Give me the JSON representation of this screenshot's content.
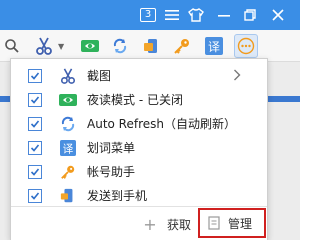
{
  "titlebar": {
    "tab_count": "3",
    "icons": [
      "tabs-count-icon",
      "menu-icon",
      "skin-icon",
      "minimize-icon",
      "restore-icon",
      "close-icon"
    ],
    "color": "#3a8ee6"
  },
  "toolbar": {
    "icons": [
      "search-icon",
      "scissors-icon",
      "night-mode-icon",
      "auto-refresh-icon",
      "account-helper-icon",
      "key-icon",
      "translate-icon",
      "more-icon"
    ]
  },
  "menu": {
    "items": [
      {
        "label": "截图",
        "icon": "scissors-icon",
        "checked": true,
        "has_submenu": true
      },
      {
        "label": "夜读模式 - 已关闭",
        "icon": "night-mode-icon",
        "checked": true,
        "has_submenu": false
      },
      {
        "label": "Auto Refresh（自动刷新）",
        "icon": "auto-refresh-icon",
        "checked": true,
        "has_submenu": false
      },
      {
        "label": "划词菜单",
        "icon": "translate-icon",
        "checked": true,
        "has_submenu": false
      },
      {
        "label": "帐号助手",
        "icon": "key-icon",
        "checked": true,
        "has_submenu": false
      },
      {
        "label": "发送到手机",
        "icon": "send-to-phone-icon",
        "checked": true,
        "has_submenu": false
      }
    ],
    "footer": {
      "get_label": "获取",
      "manage_label": "管理"
    }
  },
  "colors": {
    "accent": "#3a8ee6",
    "checkbox": "#4a86d8",
    "highlight_border": "#d0201f"
  }
}
